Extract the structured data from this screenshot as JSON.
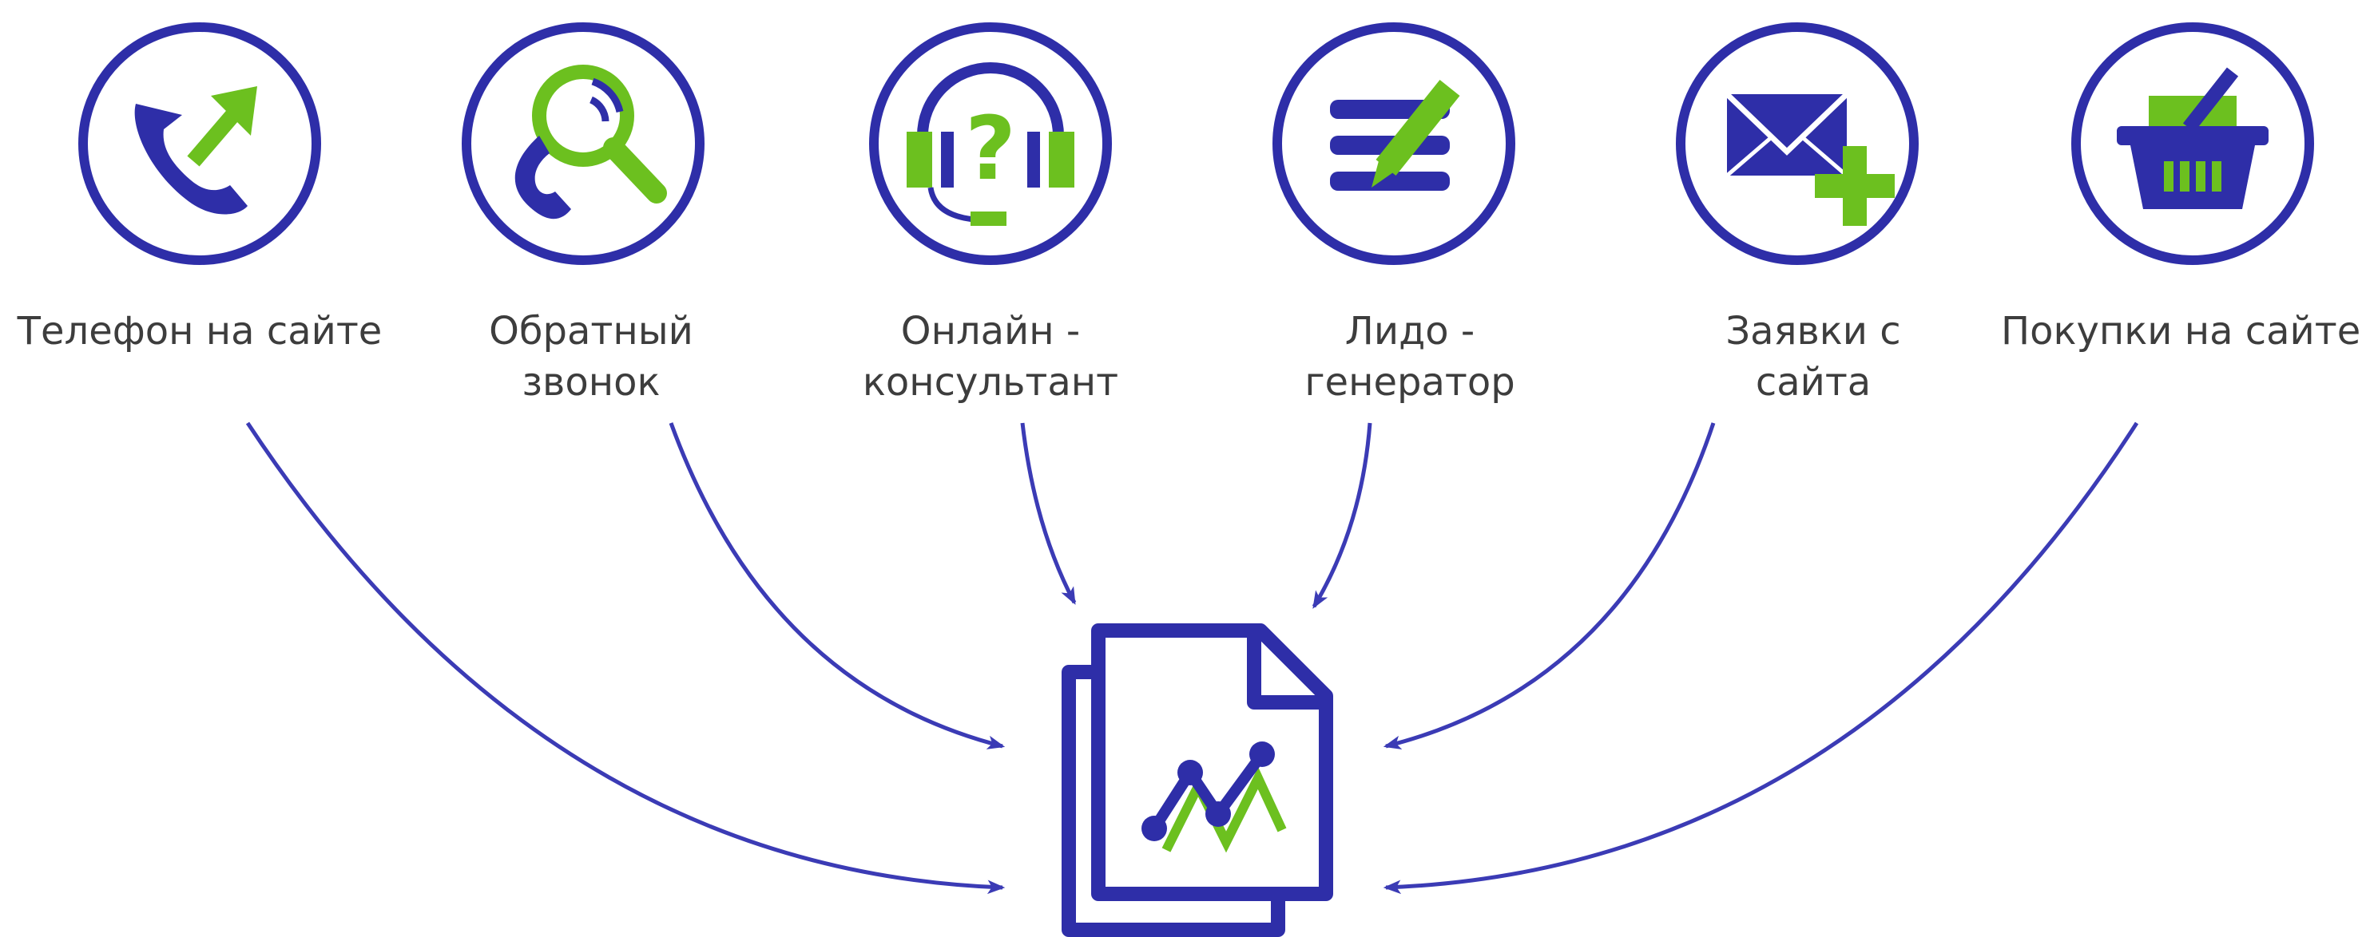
{
  "colors": {
    "ring": "#2e2ea8",
    "accent": "#6cc01f",
    "arrow": "#3b3bb5",
    "text": "#3d3d3d"
  },
  "sources": [
    {
      "icon": "phone-arrow-icon",
      "lines": [
        "Телефон на сайте"
      ]
    },
    {
      "icon": "phone-magnifier-icon",
      "lines": [
        "Обратный",
        "звонок"
      ]
    },
    {
      "icon": "headset-question-icon",
      "lines": [
        "Онлайн -",
        "консультант"
      ]
    },
    {
      "icon": "list-pencil-icon",
      "lines": [
        "Лидо -",
        "генератор"
      ]
    },
    {
      "icon": "envelope-plus-icon",
      "lines": [
        "Заявки с",
        "сайта"
      ]
    },
    {
      "icon": "basket-pencil-icon",
      "lines": [
        "Покупки на сайте"
      ]
    }
  ],
  "target": {
    "icon": "report-chart-icon"
  }
}
